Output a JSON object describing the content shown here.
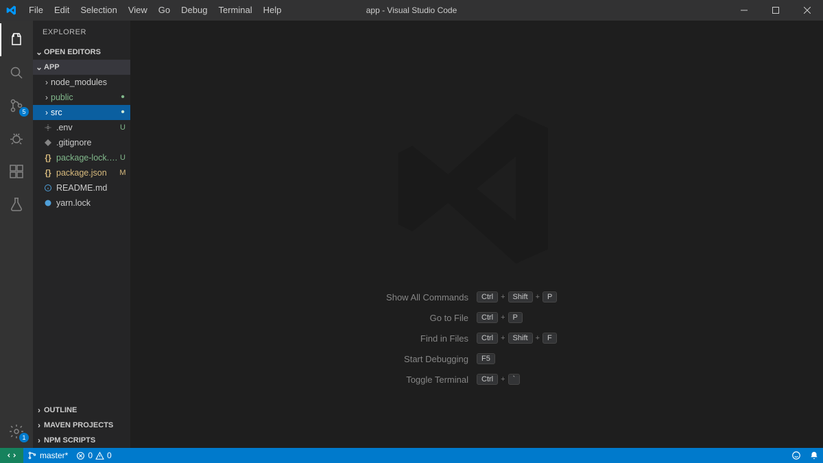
{
  "title": "app - Visual Studio Code",
  "menu": [
    "File",
    "Edit",
    "Selection",
    "View",
    "Go",
    "Debug",
    "Terminal",
    "Help"
  ],
  "sidebar": {
    "title": "EXPLORER",
    "sections": {
      "open_editors": "OPEN EDITORS",
      "app": "APP",
      "outline": "OUTLINE",
      "maven": "MAVEN PROJECTS",
      "npm": "NPM SCRIPTS"
    },
    "tree": {
      "node_modules": "node_modules",
      "public": "public",
      "src": "src",
      "env": ".env",
      "gitignore": ".gitignore",
      "package_lock": "package-lock.json",
      "package_json": "package.json",
      "readme": "README.md",
      "yarn_lock": "yarn.lock"
    },
    "decor": {
      "u": "U",
      "m": "M"
    }
  },
  "activity_badges": {
    "scm": "5",
    "settings": "1"
  },
  "welcome": {
    "show_all": {
      "label": "Show All Commands",
      "keys": [
        "Ctrl",
        "Shift",
        "P"
      ]
    },
    "goto_file": {
      "label": "Go to File",
      "keys": [
        "Ctrl",
        "P"
      ]
    },
    "find_files": {
      "label": "Find in Files",
      "keys": [
        "Ctrl",
        "Shift",
        "F"
      ]
    },
    "debug": {
      "label": "Start Debugging",
      "keys": [
        "F5"
      ]
    },
    "terminal": {
      "label": "Toggle Terminal",
      "keys": [
        "Ctrl",
        "`"
      ]
    }
  },
  "statusbar": {
    "branch": "master*",
    "errors": "0",
    "warnings": "0"
  }
}
